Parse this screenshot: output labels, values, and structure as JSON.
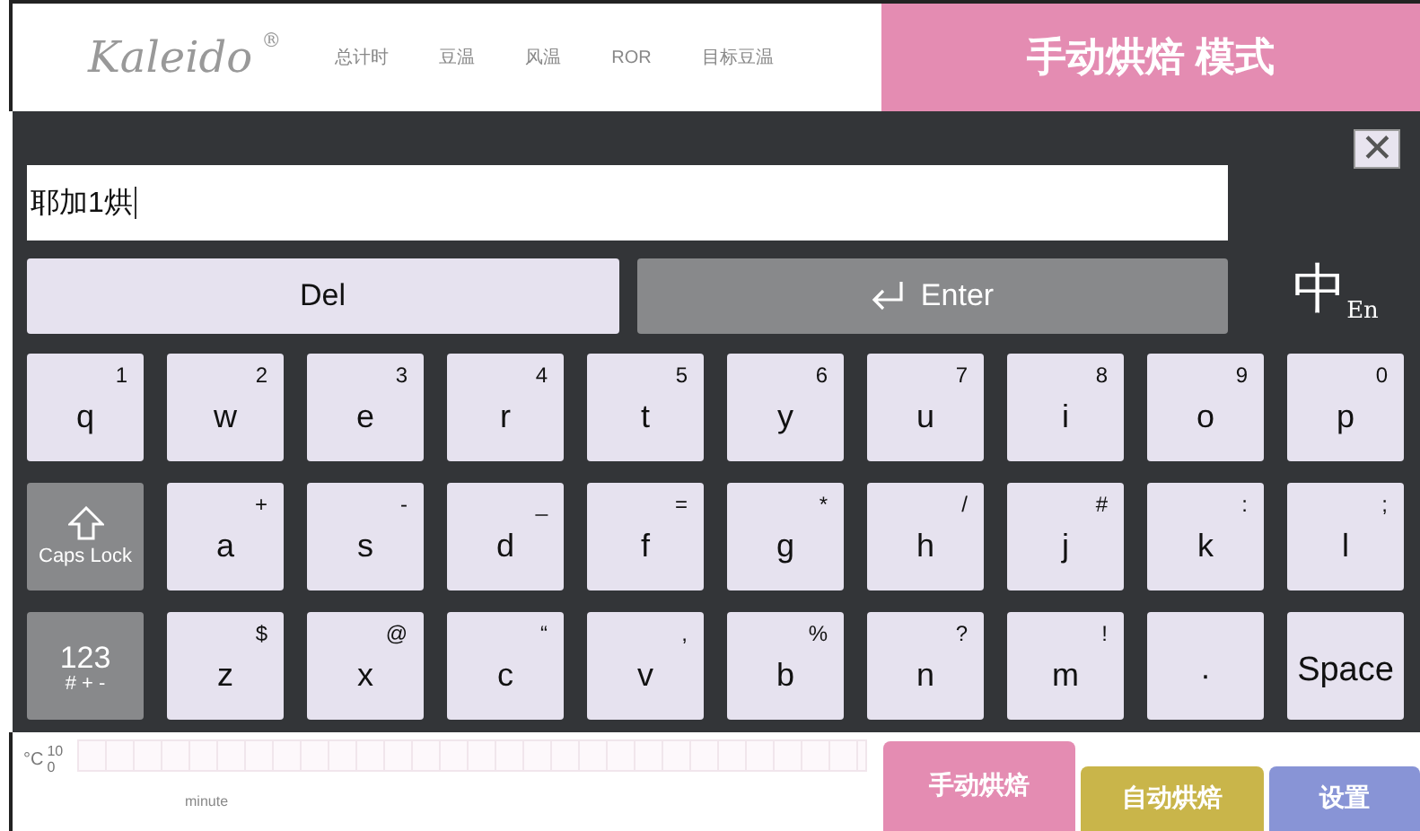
{
  "header": {
    "logo": "Kaleido",
    "logo_mark": "®",
    "stats": [
      "总计时",
      "豆温",
      "风温",
      "ROR",
      "目标豆温"
    ],
    "mode_title": "手动烘焙 模式"
  },
  "keyboard": {
    "input": {
      "value": "耶加1烘"
    },
    "close": "✕",
    "del": "Del",
    "enter": "Enter",
    "lang_main": "中",
    "lang_sub": "En",
    "rows": [
      [
        {
          "kind": "char",
          "main": "q",
          "sup": "1"
        },
        {
          "kind": "char",
          "main": "w",
          "sup": "2"
        },
        {
          "kind": "char",
          "main": "e",
          "sup": "3"
        },
        {
          "kind": "char",
          "main": "r",
          "sup": "4"
        },
        {
          "kind": "char",
          "main": "t",
          "sup": "5"
        },
        {
          "kind": "char",
          "main": "y",
          "sup": "6"
        },
        {
          "kind": "char",
          "main": "u",
          "sup": "7"
        },
        {
          "kind": "char",
          "main": "i",
          "sup": "8"
        },
        {
          "kind": "char",
          "main": "o",
          "sup": "9"
        },
        {
          "kind": "char",
          "main": "p",
          "sup": "0"
        }
      ],
      [
        {
          "kind": "caps",
          "main": "Caps Lock"
        },
        {
          "kind": "char",
          "main": "a",
          "sup": "+"
        },
        {
          "kind": "char",
          "main": "s",
          "sup": "-"
        },
        {
          "kind": "char",
          "main": "d",
          "sup": "_"
        },
        {
          "kind": "char",
          "main": "f",
          "sup": "="
        },
        {
          "kind": "char",
          "main": "g",
          "sup": "*"
        },
        {
          "kind": "char",
          "main": "h",
          "sup": "/"
        },
        {
          "kind": "char",
          "main": "j",
          "sup": "#"
        },
        {
          "kind": "char",
          "main": "k",
          "sup": ":"
        },
        {
          "kind": "char",
          "main": "l",
          "sup": ";"
        }
      ],
      [
        {
          "kind": "symbols",
          "main": "123",
          "sub": "# + -"
        },
        {
          "kind": "char",
          "main": "z",
          "sup": "$"
        },
        {
          "kind": "char",
          "main": "x",
          "sup": "@"
        },
        {
          "kind": "char",
          "main": "c",
          "sup": "“"
        },
        {
          "kind": "char",
          "main": "v",
          "sup": ","
        },
        {
          "kind": "char",
          "main": "b",
          "sup": "%"
        },
        {
          "kind": "char",
          "main": "n",
          "sup": "?"
        },
        {
          "kind": "char",
          "main": "m",
          "sup": "!"
        },
        {
          "kind": "char",
          "main": "·"
        },
        {
          "kind": "space",
          "main": "Space"
        }
      ]
    ]
  },
  "footer": {
    "chart_unit": "°C",
    "ticks": [
      "10",
      "0"
    ],
    "xlabel": "minute",
    "tabs": [
      {
        "label": "手动烘焙",
        "color": "#e48cb2"
      },
      {
        "label": "自动烘焙",
        "color": "#c9b54a"
      },
      {
        "label": "设置",
        "color": "#8894d6"
      }
    ]
  }
}
